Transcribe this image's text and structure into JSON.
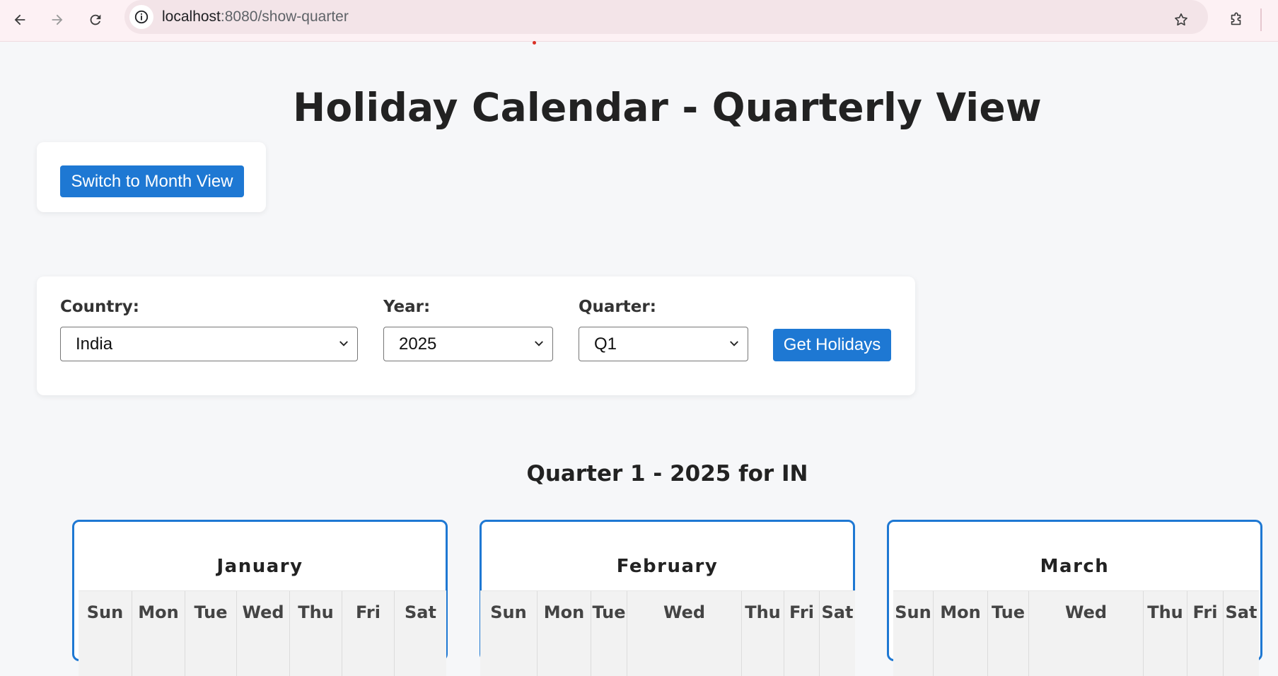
{
  "browser": {
    "url_host": "localhost",
    "url_path": ":8080/show-quarter"
  },
  "page": {
    "title": "Holiday Calendar - Quarterly View",
    "switch_button": "Switch to Month View"
  },
  "filters": {
    "country_label": "Country:",
    "country_value": "India",
    "year_label": "Year:",
    "year_value": "2025",
    "quarter_label": "Quarter:",
    "quarter_value": "Q1",
    "submit_label": "Get Holidays"
  },
  "quarter": {
    "heading": "Quarter 1 - 2025 for IN",
    "months": [
      {
        "name": "January",
        "days": [
          "Sun",
          "Mon",
          "Tue",
          "Wed",
          "Thu",
          "Fri",
          "Sat"
        ]
      },
      {
        "name": "February",
        "days": [
          "Sun",
          "Mon",
          "Tue",
          "Wed",
          "Thu",
          "Fri",
          "Sat"
        ]
      },
      {
        "name": "March",
        "days": [
          "Sun",
          "Mon",
          "Tue",
          "Wed",
          "Thu",
          "Fri",
          "Sat"
        ]
      }
    ]
  },
  "colors": {
    "accent": "#1e78d3",
    "background": "#f6f7f9"
  }
}
